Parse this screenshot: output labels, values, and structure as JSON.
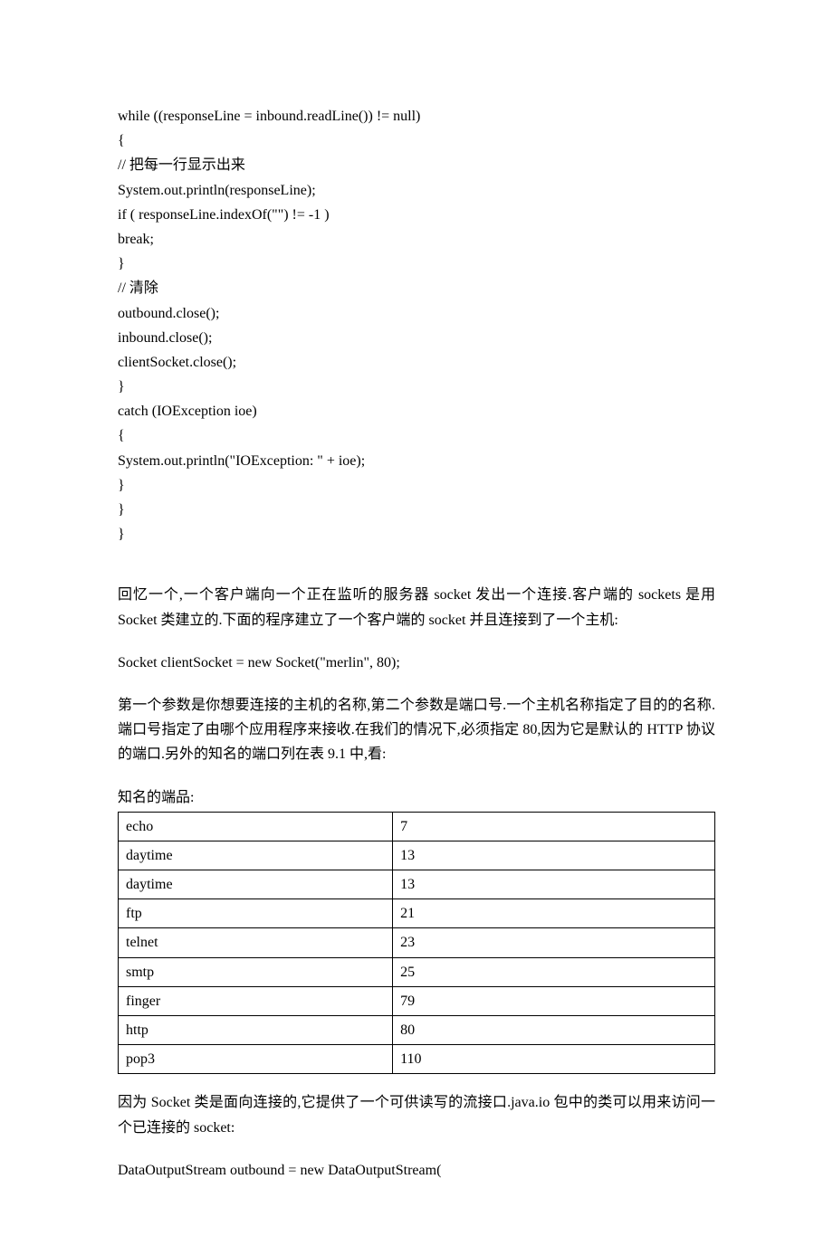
{
  "code1": "while ((responseLine = inbound.readLine()) != null)\n{\n// 把每一行显示出来\nSystem.out.println(responseLine);\nif ( responseLine.indexOf(\"\") != -1 )\nbreak;\n}\n// 清除\noutbound.close();\ninbound.close();\nclientSocket.close();\n}\ncatch (IOException ioe)\n{\nSystem.out.println(\"IOException: \" + ioe);\n}\n}\n}",
  "para1": "回忆一个,一个客户端向一个正在监听的服务器 socket 发出一个连接.客户端的 sockets 是用 Socket 类建立的.下面的程序建立了一个客户端的 socket 并且连接到了一个主机:",
  "code2": "Socket clientSocket = new Socket(\"merlin\", 80);",
  "para2": "第一个参数是你想要连接的主机的名称,第二个参数是端口号.一个主机名称指定了目的的名称.端口号指定了由哪个应用程序来接收.在我们的情况下,必须指定 80,因为它是默认的 HTTP 协议的端口.另外的知名的端口列在表 9.1 中,看:",
  "tableCaption": "知名的端品:",
  "ports": [
    {
      "name": "echo",
      "port": "7"
    },
    {
      "name": "daytime",
      "port": "13"
    },
    {
      "name": "daytime",
      "port": "13"
    },
    {
      "name": "ftp",
      "port": "21"
    },
    {
      "name": "telnet",
      "port": "23"
    },
    {
      "name": "smtp",
      "port": "25"
    },
    {
      "name": "finger",
      "port": "79"
    },
    {
      "name": "http",
      "port": "80"
    },
    {
      "name": "pop3",
      "port": "110"
    }
  ],
  "para3": "因为 Socket 类是面向连接的,它提供了一个可供读写的流接口.java.io 包中的类可以用来访问一个已连接的 socket:",
  "code3": "DataOutputStream outbound = new DataOutputStream("
}
